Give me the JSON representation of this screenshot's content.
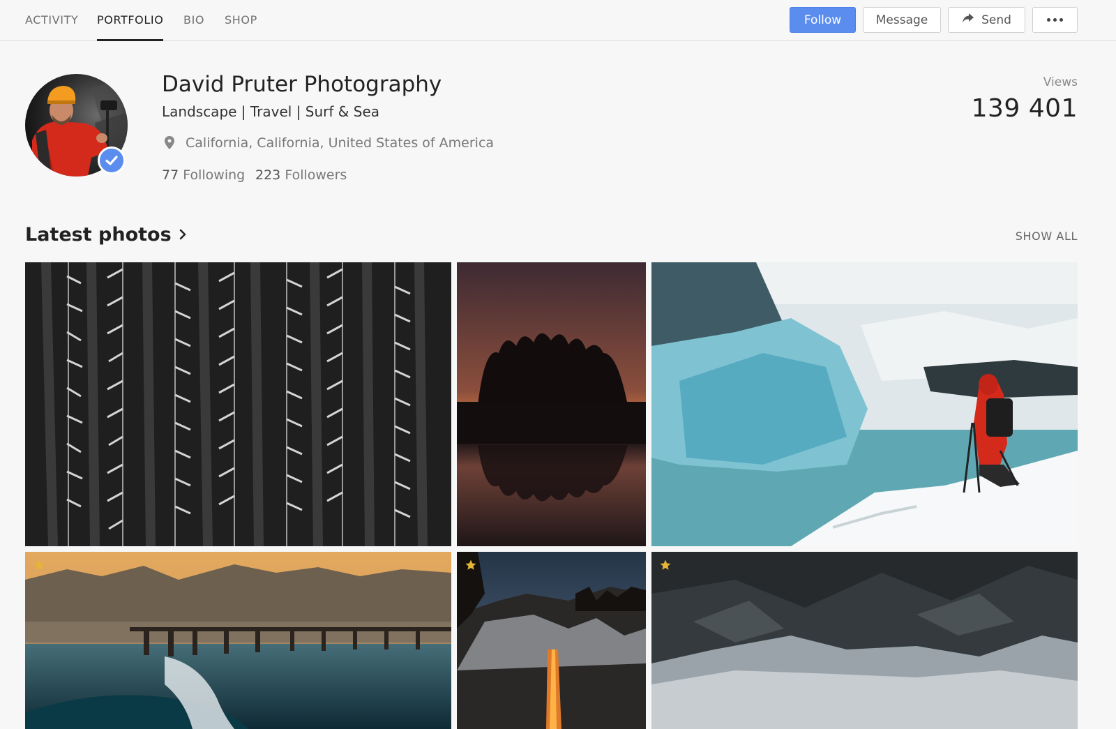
{
  "nav": {
    "tabs": [
      "ACTIVITY",
      "PORTFOLIO",
      "BIO",
      "SHOP"
    ],
    "active_tab": "PORTFOLIO"
  },
  "actions": {
    "follow": "Follow",
    "message": "Message",
    "send": "Send"
  },
  "profile": {
    "name": "David Pruter Photography",
    "tagline": "Landscape | Travel | Surf & Sea",
    "location": "California, California, United States of America",
    "following_count": "77",
    "following_label": "Following",
    "followers_count": "223",
    "followers_label": "Followers",
    "verified": true
  },
  "stats": {
    "views_label": "Views",
    "views_count": "139 401"
  },
  "latest_photos": {
    "title": "Latest photos",
    "show_all": "SHOW ALL",
    "photos": [
      {
        "subject": "snowy-forest",
        "featured": false
      },
      {
        "subject": "sunset-trees-reflection",
        "featured": false
      },
      {
        "subject": "glacier-ice-photographer",
        "featured": false
      },
      {
        "subject": "pier-wave",
        "featured": true
      },
      {
        "subject": "firefall-waterfall",
        "featured": true
      },
      {
        "subject": "snowy-mountains",
        "featured": true
      }
    ]
  },
  "colors": {
    "accent": "#5b8def",
    "star": "#e5b53a",
    "text": "#222222",
    "muted": "#777777"
  }
}
